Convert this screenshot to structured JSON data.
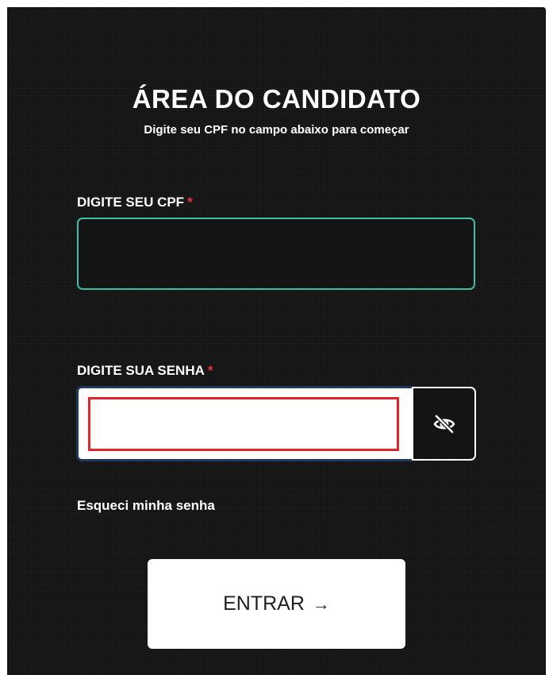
{
  "header": {
    "title": "ÁREA DO CANDIDATO",
    "subtitle": "Digite seu CPF no campo abaixo para começar"
  },
  "form": {
    "cpf_label": "DIGITE SEU CPF",
    "cpf_required_mark": "*",
    "cpf_value": "",
    "password_label": "DIGITE SUA SENHA",
    "password_required_mark": "*",
    "password_value": "",
    "toggle_icon": "eye-slash-icon",
    "forgot_label": "Esqueci minha senha",
    "submit_label": "ENTRAR",
    "submit_arrow": "→"
  },
  "colors": {
    "background": "#141414",
    "cpf_border": "#3cbfa8",
    "password_highlight": "#e0242b",
    "required": "#e53935"
  }
}
